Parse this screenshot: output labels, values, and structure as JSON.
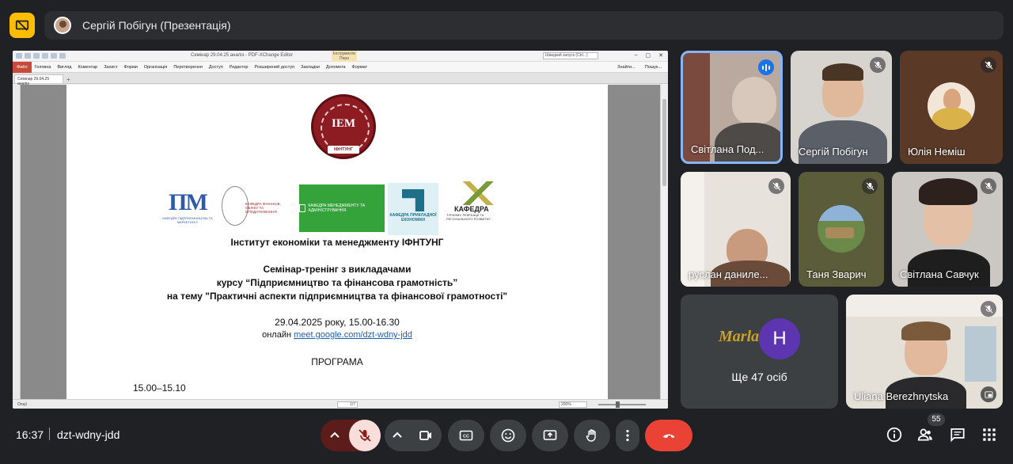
{
  "presenter": {
    "name": "Сергій Побігун (Презентація)"
  },
  "shared_screen": {
    "app": {
      "title": "Семінар 29.04.25 аналіз - PDF-XChange Editor",
      "tool_tab": "Інструменти Пера",
      "search_placeholder": "Швидкий запуск (Ctrl...)",
      "ribbon": {
        "file": "Файл",
        "items": [
          "Головна",
          "Вигляд",
          "Коментар",
          "Захист",
          "Форми",
          "Організація",
          "Перетворення",
          "Доступ",
          "Редактор",
          "Розширений доступ",
          "Закладки",
          "Допомога",
          "Формат"
        ],
        "right": [
          "Знайти...",
          "Пошук..."
        ]
      },
      "doc_tab": "Семінар 29.04.25 аналіз",
      "status_left": "Опції",
      "page_indicator": "1/7",
      "zoom": "200%"
    },
    "document": {
      "seal_text": "IEM",
      "seal_band": "ІФНТУНГ",
      "logos": {
        "pim_mark": "ПМ",
        "pim_caption": "КАФЕДРА ПІДПРИЄМНИЦТВА ТА МАРКЕТИНГУ",
        "fin_caption": "КАФЕДРА ФІНАНСІВ, ОБЛІКУ ТА ОПОДАТКУВАННЯ",
        "green_caption": "КАФЕДРА МЕНЕДЖМЕНТУ ТА АДМІНІСТРУВАННЯ",
        "pe_caption": "КАФЕДРА ПРИКЛАДНОЇ ЕКОНОМІКИ",
        "k_name": "КАФЕДРА",
        "k_caption": "ТУРИЗМУ, РЕКРЕАЦІЇ ТА РЕГІОНАЛЬНОГО РОЗВИТКУ"
      },
      "institute": "Інститут економіки та менеджменту ІФНТУНГ",
      "seminar_line1": "Семінар-тренінг з викладачами",
      "seminar_line2": "курсу “Підприємництво та фінансова грамотність”",
      "seminar_line3": "на тему \"Практичні аспекти підприємництва та фінансової грамотності\"",
      "date_line": "29.04.2025 року, 15.00-16.30",
      "online_label": "онлайн",
      "online_link": "meet.google.com/dzt-wdny-jdd",
      "program_title": "ПРОГРАМА",
      "first_slot": "15.00–15.10"
    }
  },
  "participants": [
    {
      "name": "Світлана Под...",
      "speaking": true
    },
    {
      "name": "Сергій Побігун",
      "muted": true
    },
    {
      "name": "Юлія Неміш",
      "muted": true
    },
    {
      "name": "руслан даниле...",
      "muted": true
    },
    {
      "name": "Таня Зварич",
      "muted": true
    },
    {
      "name": "Світлана Савчук",
      "muted": true
    },
    {
      "name": "Uliana Berezhnytska",
      "muted": true
    }
  ],
  "more": {
    "avatar_letter": "H",
    "background_text": "Marla",
    "label": "Ще 47 осіб"
  },
  "bottom_bar": {
    "time": "16:37",
    "meeting_code": "dzt-wdny-jdd",
    "people_count": "55"
  },
  "colors": {
    "background": "#202124",
    "tile": "#3c4043",
    "end_call": "#ea4335",
    "present_badge": "#fbbc04",
    "active_border": "#8ab4f8"
  }
}
